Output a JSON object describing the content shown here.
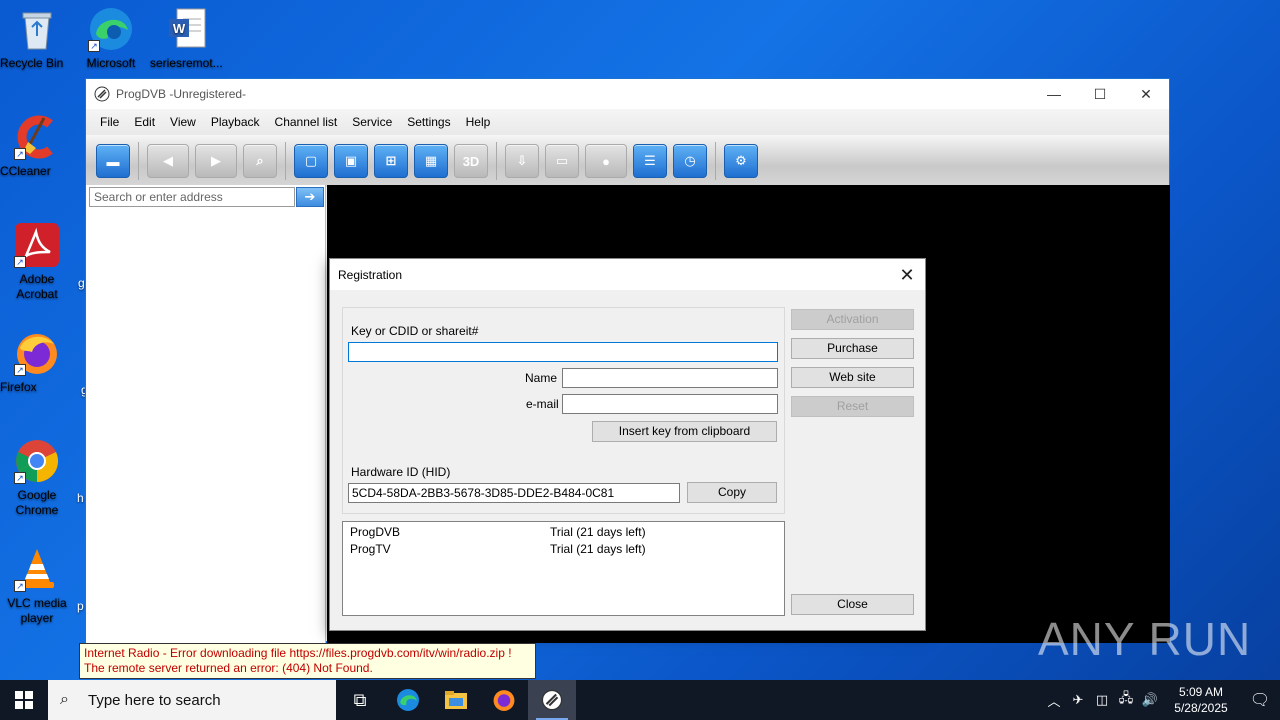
{
  "desktop": {
    "icons": [
      {
        "label": "Recycle Bin",
        "icon": "recycle-bin-icon"
      },
      {
        "label": "Microsoft Edge",
        "icon": "edge-icon"
      },
      {
        "label": "seriesremot...",
        "icon": "word-doc-icon"
      },
      {
        "label": "CCleaner",
        "icon": "ccleaner-icon"
      },
      {
        "label": "Adobe Acrobat",
        "icon": "acrobat-icon"
      },
      {
        "label": "Firefox",
        "icon": "firefox-icon"
      },
      {
        "label": "Google Chrome",
        "icon": "chrome-icon"
      },
      {
        "label": "VLC media player",
        "icon": "vlc-icon"
      }
    ]
  },
  "window": {
    "title": "ProgDVB -Unregistered-",
    "menu": [
      "File",
      "Edit",
      "View",
      "Playback",
      "Channel list",
      "Service",
      "Settings",
      "Help"
    ],
    "toolbar_3d": "3D",
    "address_placeholder": "Search or enter address"
  },
  "dialog": {
    "title": "Registration",
    "key_label": "Key or CDID or shareit#",
    "key_value": "",
    "name_label": "Name",
    "name_value": "",
    "email_label": "e-mail",
    "email_value": "",
    "insert_key_label": "Insert key from clipboard",
    "hid_label": "Hardware ID (HID)",
    "hid_value": "5CD4-58DA-2BB3-5678-3D85-DDE2-B484-0C81",
    "copy_label": "Copy",
    "activation_label": "Activation",
    "purchase_label": "Purchase",
    "website_label": "Web site",
    "reset_label": "Reset",
    "close_label": "Close",
    "products": [
      {
        "name": "ProgDVB",
        "status": "Trial (21 days left)"
      },
      {
        "name": "ProgTV",
        "status": "Trial (21 days left)"
      }
    ]
  },
  "notice": {
    "line1": "Internet Radio - Error downloading file https://files.progdvb.com/itv/win/radio.zip !",
    "line2": "The remote server returned an error: (404) Not Found."
  },
  "watermark": "ANY RUN",
  "taskbar": {
    "search_placeholder": "Type here to search",
    "time": "5:09 AM",
    "date": "5/28/2025"
  }
}
